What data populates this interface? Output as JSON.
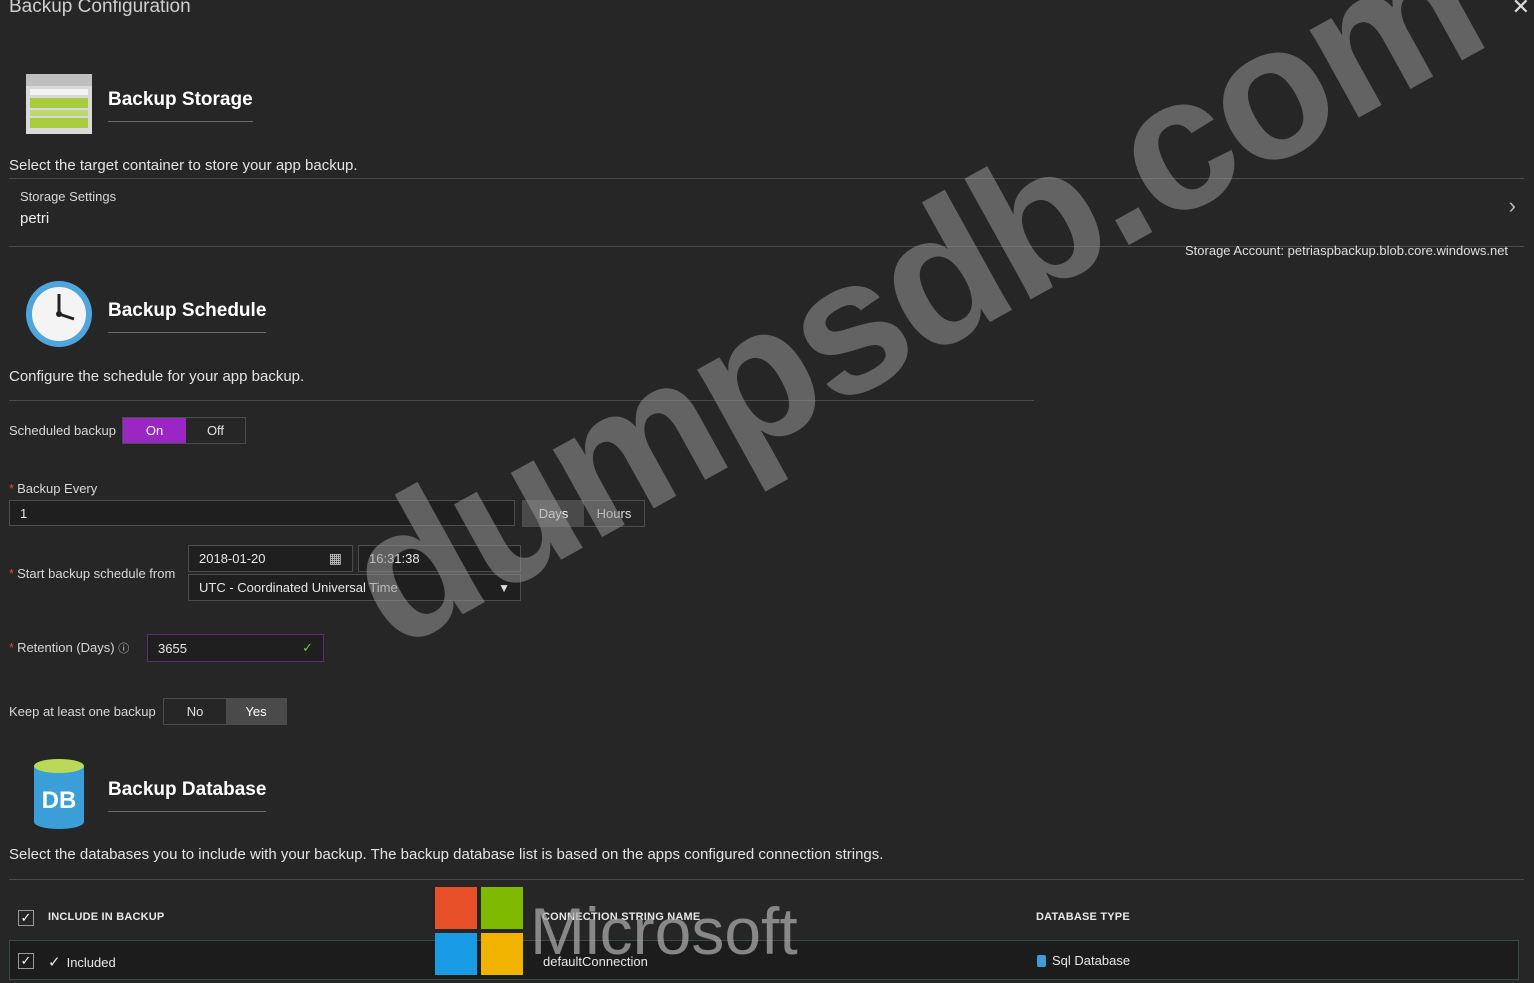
{
  "window": {
    "title": "Backup Configuration",
    "close_icon": "close-icon"
  },
  "storage": {
    "title": "Backup Storage",
    "description": "Select the target container to store your app backup.",
    "settings_label": "Storage Settings",
    "settings_value": "petri",
    "account_text": "Storage Account: petriaspbackup.blob.core.windows.net"
  },
  "schedule": {
    "title": "Backup Schedule",
    "description": "Configure the schedule for your app backup.",
    "scheduled_backup_label": "Scheduled backup",
    "on_label": "On",
    "off_label": "Off",
    "scheduled_backup_value": "On",
    "backup_every_label": "Backup Every",
    "backup_every_value": "1",
    "days_label": "Days",
    "hours_label": "Hours",
    "unit_value": "Days",
    "start_label": "Start backup schedule from",
    "start_date": "2018-01-20",
    "start_time": "16:31:38",
    "timezone": "UTC - Coordinated Universal Time",
    "retention_label": "Retention (Days)",
    "retention_value": "3655",
    "keep_label": "Keep at least one backup",
    "no_label": "No",
    "yes_label": "Yes",
    "keep_value": "Yes",
    "accent_on": "#9a26c4"
  },
  "database": {
    "title": "Backup Database",
    "description": "Select the databases you to include with your backup. The backup database list is based on the apps configured connection strings.",
    "columns": [
      "INCLUDE IN BACKUP",
      "CONNECTION STRING NAME",
      "DATABASE TYPE"
    ],
    "rows": [
      {
        "include": "Included",
        "connection": "defaultConnection",
        "type": "Sql Database"
      }
    ]
  },
  "watermarks": {
    "main": "dumpsdb.com",
    "brand": "Microsoft"
  }
}
